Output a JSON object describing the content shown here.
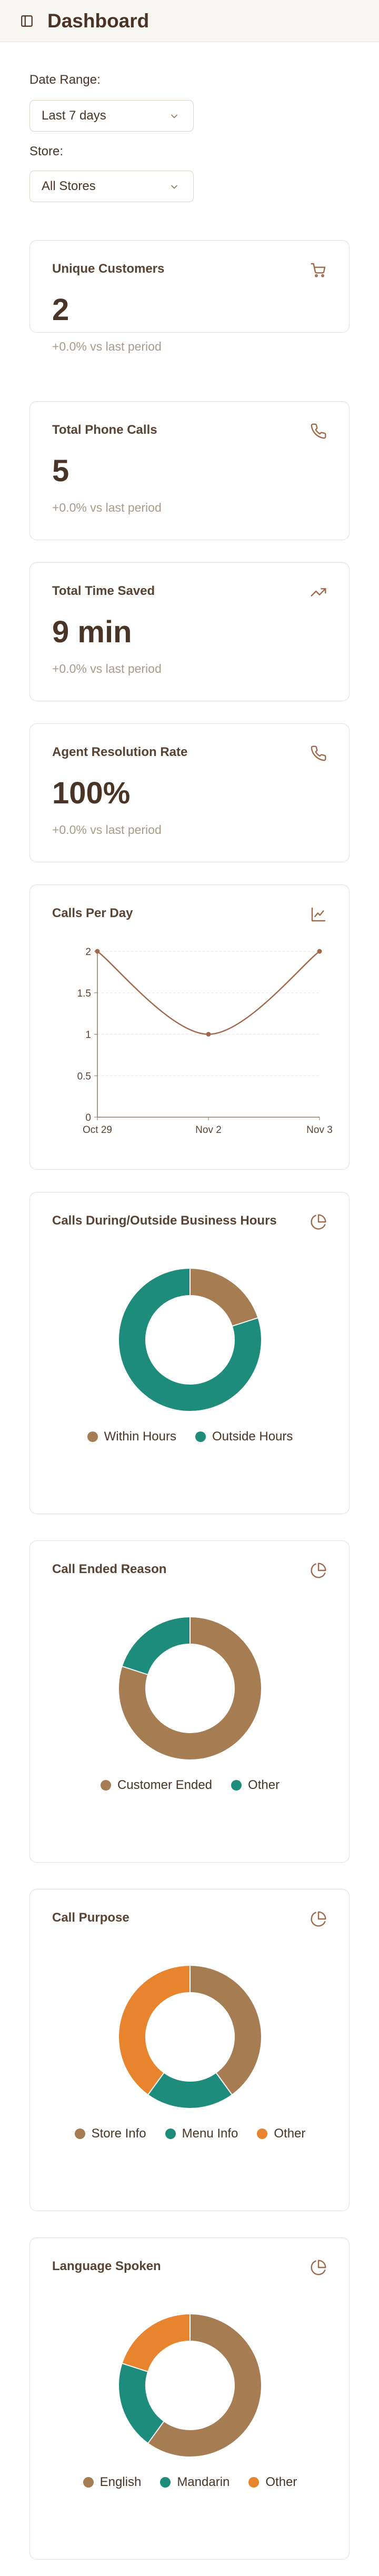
{
  "header": {
    "title": "Dashboard"
  },
  "filters": {
    "date_range_label": "Date Range:",
    "date_range_value": "Last 7 days",
    "store_label": "Store:",
    "store_value": "All Stores"
  },
  "metrics": [
    {
      "title": "Unique Customers",
      "value": "2",
      "delta": "+0.0% vs last period",
      "icon": "cart-icon"
    },
    {
      "title": "Total Phone Calls",
      "value": "5",
      "delta": "+0.0% vs last period",
      "icon": "phone-icon"
    },
    {
      "title": "Total Time Saved",
      "value": "9 min",
      "delta": "+0.0% vs last period",
      "icon": "trending-up-icon"
    },
    {
      "title": "Agent Resolution Rate",
      "value": "100%",
      "delta": "+0.0% vs last period",
      "icon": "phone-icon"
    }
  ],
  "colors": {
    "brown": "#a67c52",
    "teal": "#1e8c7a",
    "orange": "#e8832e",
    "line": "#a0694a"
  },
  "chart_data": [
    {
      "type": "line",
      "title": "Calls Per Day",
      "icon": "line-chart-icon",
      "x": [
        "Oct 29",
        "Nov 2",
        "Nov 3"
      ],
      "series": [
        {
          "values": [
            2,
            1,
            2
          ]
        }
      ],
      "yticks": [
        "0",
        "0.5",
        "1",
        "1.5",
        "2"
      ],
      "ylim": [
        0,
        2
      ],
      "grid": true
    },
    {
      "type": "pie",
      "title": "Calls During/Outside Business Hours",
      "icon": "pie-chart-icon",
      "labels": [
        "Within Hours",
        "Outside Hours"
      ],
      "values": [
        1,
        4
      ]
    },
    {
      "type": "pie",
      "title": "Call Ended Reason",
      "icon": "pie-chart-icon",
      "labels": [
        "Customer Ended",
        "Other"
      ],
      "values": [
        4,
        1
      ]
    },
    {
      "type": "pie",
      "title": "Call Purpose",
      "icon": "pie-chart-icon",
      "labels": [
        "Store Info",
        "Menu Info",
        "Other"
      ],
      "values": [
        2,
        1,
        2
      ]
    },
    {
      "type": "pie",
      "title": "Language Spoken",
      "icon": "pie-chart-icon",
      "labels": [
        "English",
        "Mandarin",
        "Other"
      ],
      "values": [
        3,
        1,
        1
      ]
    }
  ]
}
